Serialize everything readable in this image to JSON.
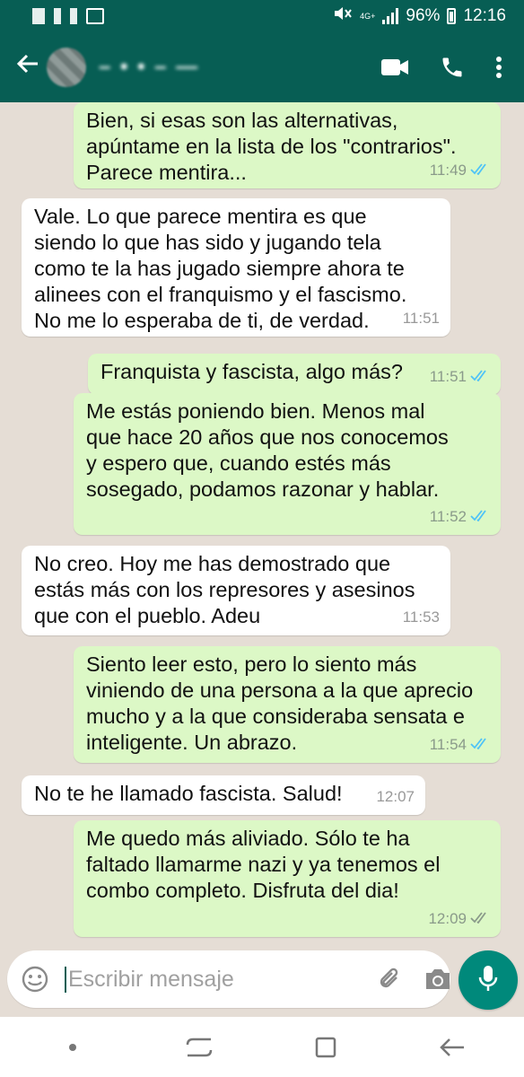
{
  "status_bar": {
    "network": "4G+",
    "battery": "96%",
    "time": "12:16"
  },
  "header": {
    "contact_name": "– • • – —",
    "icons": [
      "back-arrow-icon",
      "video-call-icon",
      "phone-call-icon",
      "more-options-icon"
    ]
  },
  "messages": [
    {
      "dir": "out",
      "text": "Bien, si esas son las alternativas,\napúntame en la lista de los \"contrarios\".\nParece mentira...",
      "time": "11:49",
      "ticks": "read"
    },
    {
      "dir": "in",
      "text": "Vale. Lo que parece mentira es que\nsiendo lo que has sido y jugando tela\ncomo te la has jugado siempre ahora te\nalinees con el franquismo y el fascismo.\nNo me lo esperaba de ti, de verdad.",
      "time": "11:51"
    },
    {
      "dir": "out",
      "text": "Franquista y fascista, algo más?",
      "time": "11:51",
      "ticks": "read"
    },
    {
      "dir": "out",
      "text": "Me estás poniendo bien. Menos mal\nque hace 20 años que nos conocemos\ny espero que, cuando estés más\nsosegado, podamos razonar y hablar.",
      "time": "11:52",
      "ticks": "read"
    },
    {
      "dir": "in",
      "text": "No creo. Hoy me has demostrado que\nestás más con los represores y asesinos\nque con el pueblo. Adeu",
      "time": "11:53"
    },
    {
      "dir": "out",
      "text": "Siento leer esto, pero lo siento más\nviniendo de una persona a la que aprecio\nmucho y a la que consideraba sensata e\ninteligente. Un abrazo.",
      "time": "11:54",
      "ticks": "read"
    },
    {
      "dir": "in",
      "text": "No te he llamado fascista. Salud!",
      "time": "12:07"
    },
    {
      "dir": "out",
      "text": "Me quedo más aliviado. Sólo te ha\nfaltado llamarme nazi y ya tenemos el\ncombo completo. Disfruta del dia!",
      "time": "12:09",
      "ticks": "delivered"
    }
  ],
  "composer": {
    "placeholder": "Escribir mensaje",
    "icons": [
      "emoji-icon",
      "attach-icon",
      "camera-icon",
      "microphone-icon"
    ]
  },
  "colors": {
    "header": "#075e54",
    "outgoing_bubble": "#dcf8c6",
    "incoming_bubble": "#ffffff",
    "chat_background": "#e5ddd5",
    "read_ticks": "#4fc3f7",
    "mic_button": "#00897b"
  },
  "nav": {
    "icons": [
      "dot-icon",
      "recent-apps-icon",
      "home-icon",
      "back-icon"
    ]
  }
}
